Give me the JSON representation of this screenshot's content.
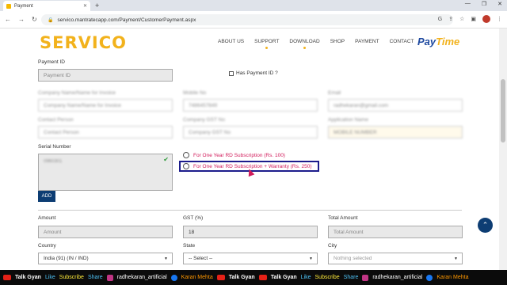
{
  "browser": {
    "tab_title": "Payment",
    "tab_close": "✕",
    "new_tab": "+",
    "url": "servico.mantratecapp.com/Payment/CustomerPayment.aspx",
    "window_controls": [
      "—",
      "❐",
      "✕"
    ]
  },
  "site": {
    "logo": "SERVICO",
    "menu": [
      "ABOUT US",
      "SUPPORT",
      "DOWNLOAD",
      "SHOP",
      "PAYMENT",
      "CONTACT"
    ],
    "paytime_pay": "Pay",
    "paytime_time": "Time"
  },
  "form": {
    "payment_id_label": "Payment ID",
    "payment_id_placeholder": "Payment ID",
    "has_payment_id_label": "Has Payment ID ?",
    "blurred_labels": [
      "Company Name/Name for Invoice",
      "Mobile No",
      "Email",
      "Contact Person",
      "Company GST No",
      "Application Name"
    ],
    "blurred_values": [
      "Company Name/Name for Invoice",
      "7486457849",
      "radhekaran@gmail.com",
      "Contact Person",
      "Company GST No",
      "MOBILE NUMBER"
    ],
    "serial_number_label": "Serial Number",
    "serial_value": "0960301",
    "add_button": "ADD",
    "radio_options": [
      "For One Year RD Subscription (Rs. 100)",
      "For One Year RD Subscription + Warranty (Rs. 250)"
    ],
    "amount_label": "Amount",
    "amount_placeholder": "Amount",
    "gst_label": "GST (%)",
    "gst_value": "18",
    "total_label": "Total Amount",
    "total_placeholder": "Total Amount",
    "country_label": "Country",
    "country_value": "India (91) (IN / IND)",
    "state_label": "State",
    "state_value": "-- Select --",
    "city_label": "City",
    "city_value": "Nothing selected"
  },
  "ticker": {
    "talk_gyan": "Talk Gyan",
    "like": "Like",
    "subscribe": "Subscribe",
    "share": "Share",
    "instagram": "radhekaran_artificial",
    "facebook": "Karan Mehta"
  }
}
